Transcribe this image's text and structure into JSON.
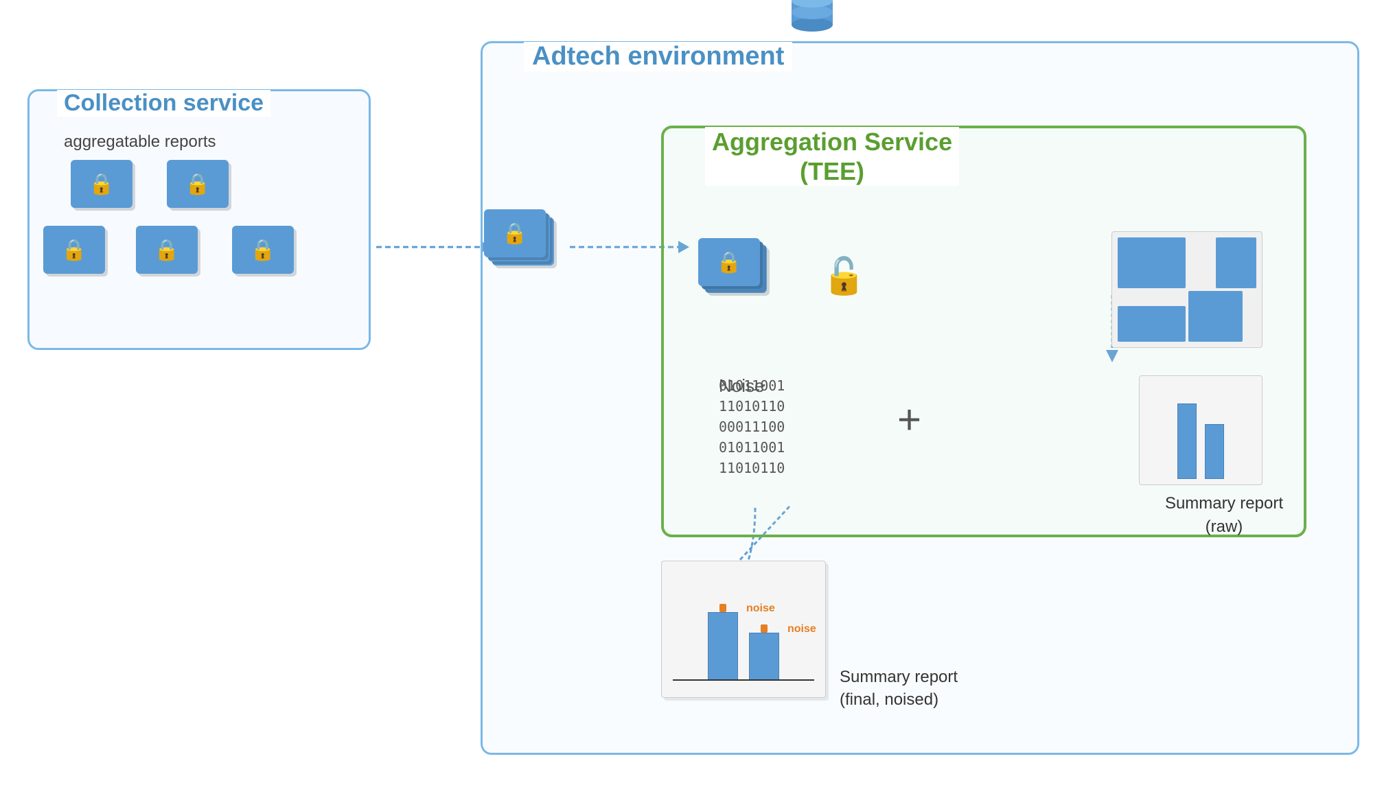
{
  "adtech": {
    "label": "Adtech environment"
  },
  "collection": {
    "label": "Collection service",
    "sublabel": "aggregatable reports"
  },
  "aggregation": {
    "label": "Aggregation Service",
    "sublabel": "(TEE)"
  },
  "noise": {
    "label": "Noise",
    "binary": "01011001\n11010110\n00011100\n01011001\n11010110"
  },
  "summary_raw": {
    "label": "Summary report\n(raw)"
  },
  "summary_final": {
    "label": "Summary report\n(final, noised)"
  },
  "noise_tag1": "noise",
  "noise_tag2": "noise"
}
